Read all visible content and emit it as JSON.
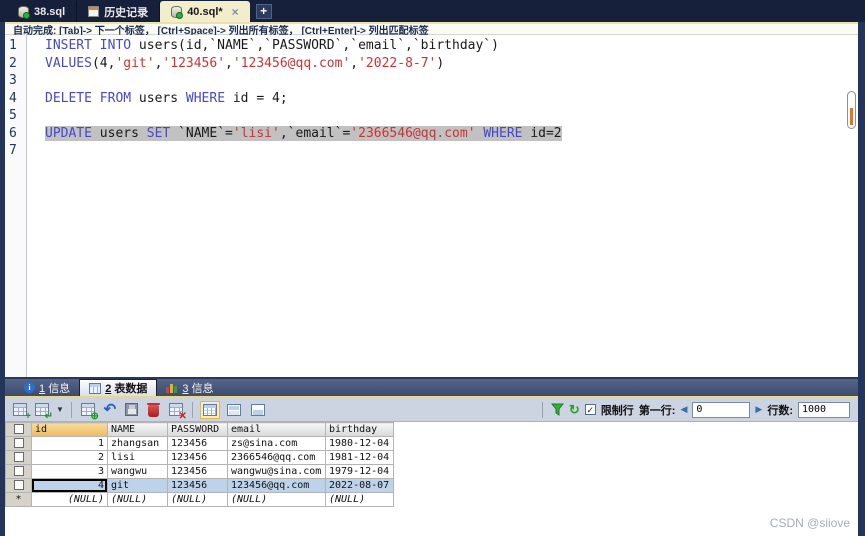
{
  "colors": {
    "titlebar_bg": "#17203a",
    "active_tab_bg": "#f2edca",
    "accent_yellow": "#ecd77c",
    "toolbar_bg": "#ccd4e2",
    "keyword": "#4747cd",
    "string": "#cc3333",
    "plain": "#1a1a1a",
    "selection_bg": "#c1c1c1",
    "selected_row_bg": "#bdd3eb",
    "sorted_header_bg": "#eebb5e",
    "scroll_marker_orange": "#e8731e"
  },
  "top_tabs": {
    "tabs": [
      {
        "label": "38.sql",
        "icon": "database-icon",
        "active": false
      },
      {
        "label": "历史记录",
        "icon": "history-icon",
        "active": false
      },
      {
        "label": "40.sql*",
        "icon": "database-icon",
        "active": true,
        "close": "×"
      }
    ],
    "new_tab_label": "+"
  },
  "hint_bar": {
    "text": "自动完成: [Tab]-> 下一个标签， [Ctrl+Space]-> 列出所有标签， [Ctrl+Enter]-> 列出匹配标签"
  },
  "editor": {
    "lines": [
      {
        "num": 1,
        "selected": false,
        "tokens": [
          {
            "t": "kw",
            "s": "INSERT INTO"
          },
          {
            "t": "pl",
            "s": " users(id,`NAME`,`PASSWORD`,`email`,`birthday`)"
          }
        ]
      },
      {
        "num": 2,
        "selected": false,
        "tokens": [
          {
            "t": "kw",
            "s": "VALUES"
          },
          {
            "t": "pl",
            "s": "(4,"
          },
          {
            "t": "str",
            "s": "'git'"
          },
          {
            "t": "pl",
            "s": ","
          },
          {
            "t": "str",
            "s": "'123456'"
          },
          {
            "t": "pl",
            "s": ","
          },
          {
            "t": "str",
            "s": "'123456@qq.com'"
          },
          {
            "t": "pl",
            "s": ","
          },
          {
            "t": "str",
            "s": "'2022-8-7'"
          },
          {
            "t": "pl",
            "s": ")"
          }
        ]
      },
      {
        "num": 3,
        "selected": false,
        "tokens": []
      },
      {
        "num": 4,
        "selected": false,
        "tokens": [
          {
            "t": "kw",
            "s": "DELETE FROM"
          },
          {
            "t": "pl",
            "s": " users "
          },
          {
            "t": "kw",
            "s": "WHERE"
          },
          {
            "t": "pl",
            "s": " id = 4;"
          }
        ]
      },
      {
        "num": 5,
        "selected": false,
        "tokens": []
      },
      {
        "num": 6,
        "selected": true,
        "tokens": [
          {
            "t": "kw",
            "s": "UPDATE"
          },
          {
            "t": "pl",
            "s": " users "
          },
          {
            "t": "kw",
            "s": "SET"
          },
          {
            "t": "pl",
            "s": " `NAME`="
          },
          {
            "t": "str",
            "s": "'lisi'"
          },
          {
            "t": "pl",
            "s": ",`email`="
          },
          {
            "t": "str",
            "s": "'2366546@qq.com'"
          },
          {
            "t": "pl",
            "s": " "
          },
          {
            "t": "kw",
            "s": "WHERE"
          },
          {
            "t": "pl",
            "s": " id=2"
          }
        ]
      },
      {
        "num": 7,
        "selected": false,
        "tokens": []
      }
    ]
  },
  "bottom_tabs": {
    "tabs": [
      {
        "num": "1",
        "label": "信息",
        "icon": "info-icon",
        "active": false
      },
      {
        "num": "2",
        "label": "表数据",
        "icon": "table-icon",
        "active": true
      },
      {
        "num": "3",
        "label": "信息",
        "icon": "chart-icon",
        "active": false
      }
    ]
  },
  "toolbar": {
    "icons": [
      "add-row-icon",
      "insert-row-dropdown-icon",
      "new-row-commit-icon",
      "undo-icon",
      "save-icon",
      "delete-row-icon",
      "discard-changes-icon",
      "grid-view-icon",
      "form-view-icon",
      "text-view-icon",
      "filter-icon",
      "refresh-icon"
    ],
    "limit": {
      "checkbox_label": "限制行",
      "checked": true,
      "first_row_label": "第一行:",
      "first_row_value": "0",
      "row_count_label": "行数:",
      "row_count_value": "1000"
    }
  },
  "table": {
    "columns": [
      "id",
      "NAME",
      "PASSWORD",
      "email",
      "birthday"
    ],
    "rows": [
      [
        "1",
        "zhangsan",
        "123456",
        "zs@sina.com",
        "1980-12-04"
      ],
      [
        "2",
        "lisi",
        "123456",
        "2366546@qq.com",
        "1981-12-04"
      ],
      [
        "3",
        "wangwu",
        "123456",
        "wangwu@sina.com",
        "1979-12-04"
      ],
      [
        "4",
        "git",
        "123456",
        "123456@qq.com",
        "2022-08-07"
      ],
      [
        "(NULL)",
        "(NULL)",
        "(NULL)",
        "(NULL)",
        "(NULL)"
      ]
    ],
    "selected_row_index": 3,
    "null_row_marker": "*"
  },
  "window": {
    "watermark": "CSDN @siiove"
  }
}
